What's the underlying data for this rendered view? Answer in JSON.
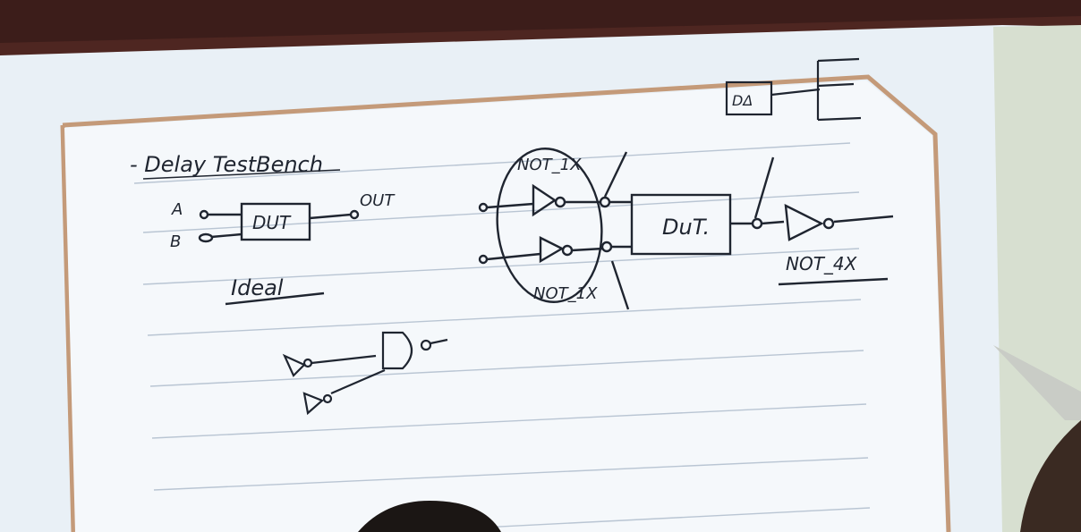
{
  "photo": {
    "description_labels": {
      "title": "- Delay TestBench",
      "input_a": "A",
      "input_b": "B",
      "dut_left": "DUT",
      "out_label": "OUT",
      "ideal_label": "Ideal",
      "not_top": "NOT_1X",
      "not_bottom": "NOT_1X",
      "dut_right": "DuT.",
      "not_out": "NOT_4X",
      "corner_box": "DΔ"
    },
    "colors": {
      "wall": "#5a2a24",
      "screen": "#eef4f9",
      "border": "#c59a7a",
      "ink": "#1f2530",
      "rule_line": "#b8c4d2"
    }
  }
}
